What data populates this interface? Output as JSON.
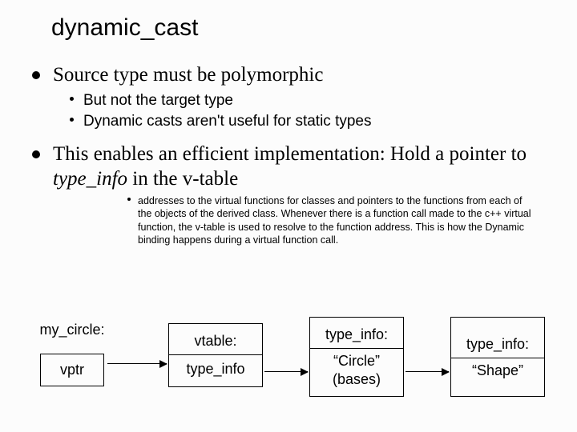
{
  "title": "dynamic_cast",
  "bullet1": "Source type must be polymorphic",
  "bullet1_sub1": "But not the target type",
  "bullet1_sub2": "Dynamic casts aren't useful for static types",
  "bullet2_a": "This enables an efficient implementation: Hold a pointer to ",
  "bullet2_ti": "type_info",
  "bullet2_b": " in the v-table",
  "bullet2_sub1": "addresses to the virtual functions for classes and pointers to the functions from each of the objects of the derived class. Whenever there is a function call made to the c++ virtual function, the v-table is used to resolve to the function address. This is how the Dynamic binding happens during a virtual function call.",
  "box1a": "my_circle:",
  "box1b": "vptr",
  "box2a": "vtable:",
  "box2b": "type_info",
  "box3a": "type_info:",
  "box3b": "“Circle”",
  "box3c": "(bases)",
  "box4a": "type_info:",
  "box4b": "“Shape”"
}
